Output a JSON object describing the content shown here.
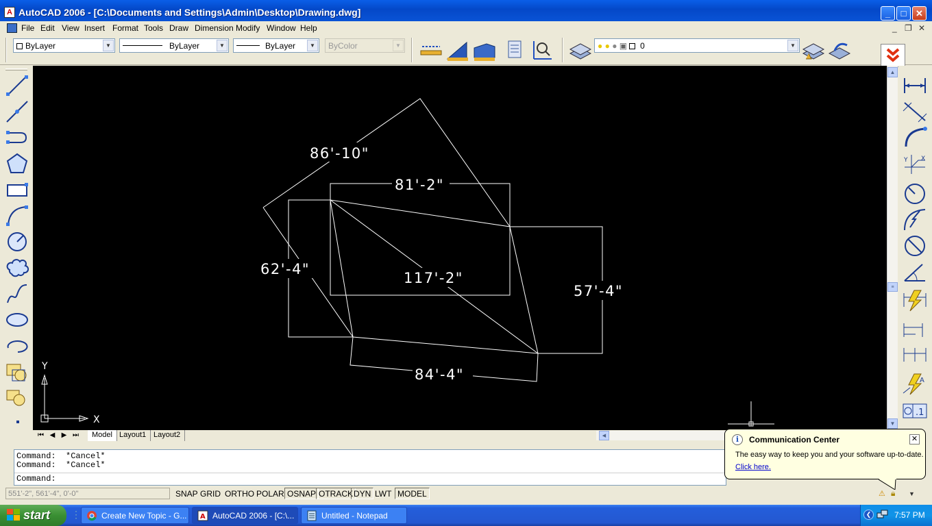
{
  "window": {
    "title": "AutoCAD 2006 - [C:\\Documents and Settings\\Admin\\Desktop\\Drawing.dwg]",
    "app_icon": "autocad-icon"
  },
  "menu": {
    "items": [
      "File",
      "Edit",
      "View",
      "Insert",
      "Format",
      "Tools",
      "Draw",
      "Dimension",
      "Modify",
      "Window",
      "Help"
    ]
  },
  "properties": {
    "color": "ByLayer",
    "linetype": "ByLayer",
    "lineweight": "ByLayer",
    "plotstyle": "ByColor",
    "layer": "0"
  },
  "drawing": {
    "dimensions": [
      "86'-10\"",
      "81'-2\"",
      "62'-4\"",
      "117'-2\"",
      "57'-4\"",
      "84'-4\""
    ],
    "ucs_x": "X",
    "ucs_y": "Y"
  },
  "tabs": [
    "Model",
    "Layout1",
    "Layout2"
  ],
  "command": {
    "history": [
      "Command:  *Cancel*",
      "Command:  *Cancel*"
    ],
    "prompt": "Command:"
  },
  "status": {
    "coords": "551'-2\",  561'-4\",  0'-0\"",
    "toggles": [
      {
        "label": "SNAP",
        "on": false
      },
      {
        "label": "GRID",
        "on": false
      },
      {
        "label": "ORTHO",
        "on": false
      },
      {
        "label": "POLAR",
        "on": false
      },
      {
        "label": "OSNAP",
        "on": true
      },
      {
        "label": "OTRACK",
        "on": true
      },
      {
        "label": "DYN",
        "on": true
      },
      {
        "label": "LWT",
        "on": false
      },
      {
        "label": "MODEL",
        "on": true
      }
    ]
  },
  "balloon": {
    "title": "Communication Center",
    "body": "The easy way to keep you and your software up-to-date.",
    "link": "Click here."
  },
  "taskbar": {
    "start": "start",
    "items": [
      {
        "label": "Create New Topic - G...",
        "icon": "chrome-icon",
        "active": false
      },
      {
        "label": "AutoCAD 2006 - [C:\\...",
        "icon": "autocad-icon",
        "active": true
      },
      {
        "label": "Untitled - Notepad",
        "icon": "notepad-icon",
        "active": false
      }
    ],
    "clock": "7:57 PM"
  },
  "colors": {
    "canvas": "#000000",
    "drawing_lines": "#ffffff",
    "title_bar": "#0a55d8",
    "taskbar": "#245edb",
    "start_button": "#3a8f33"
  }
}
